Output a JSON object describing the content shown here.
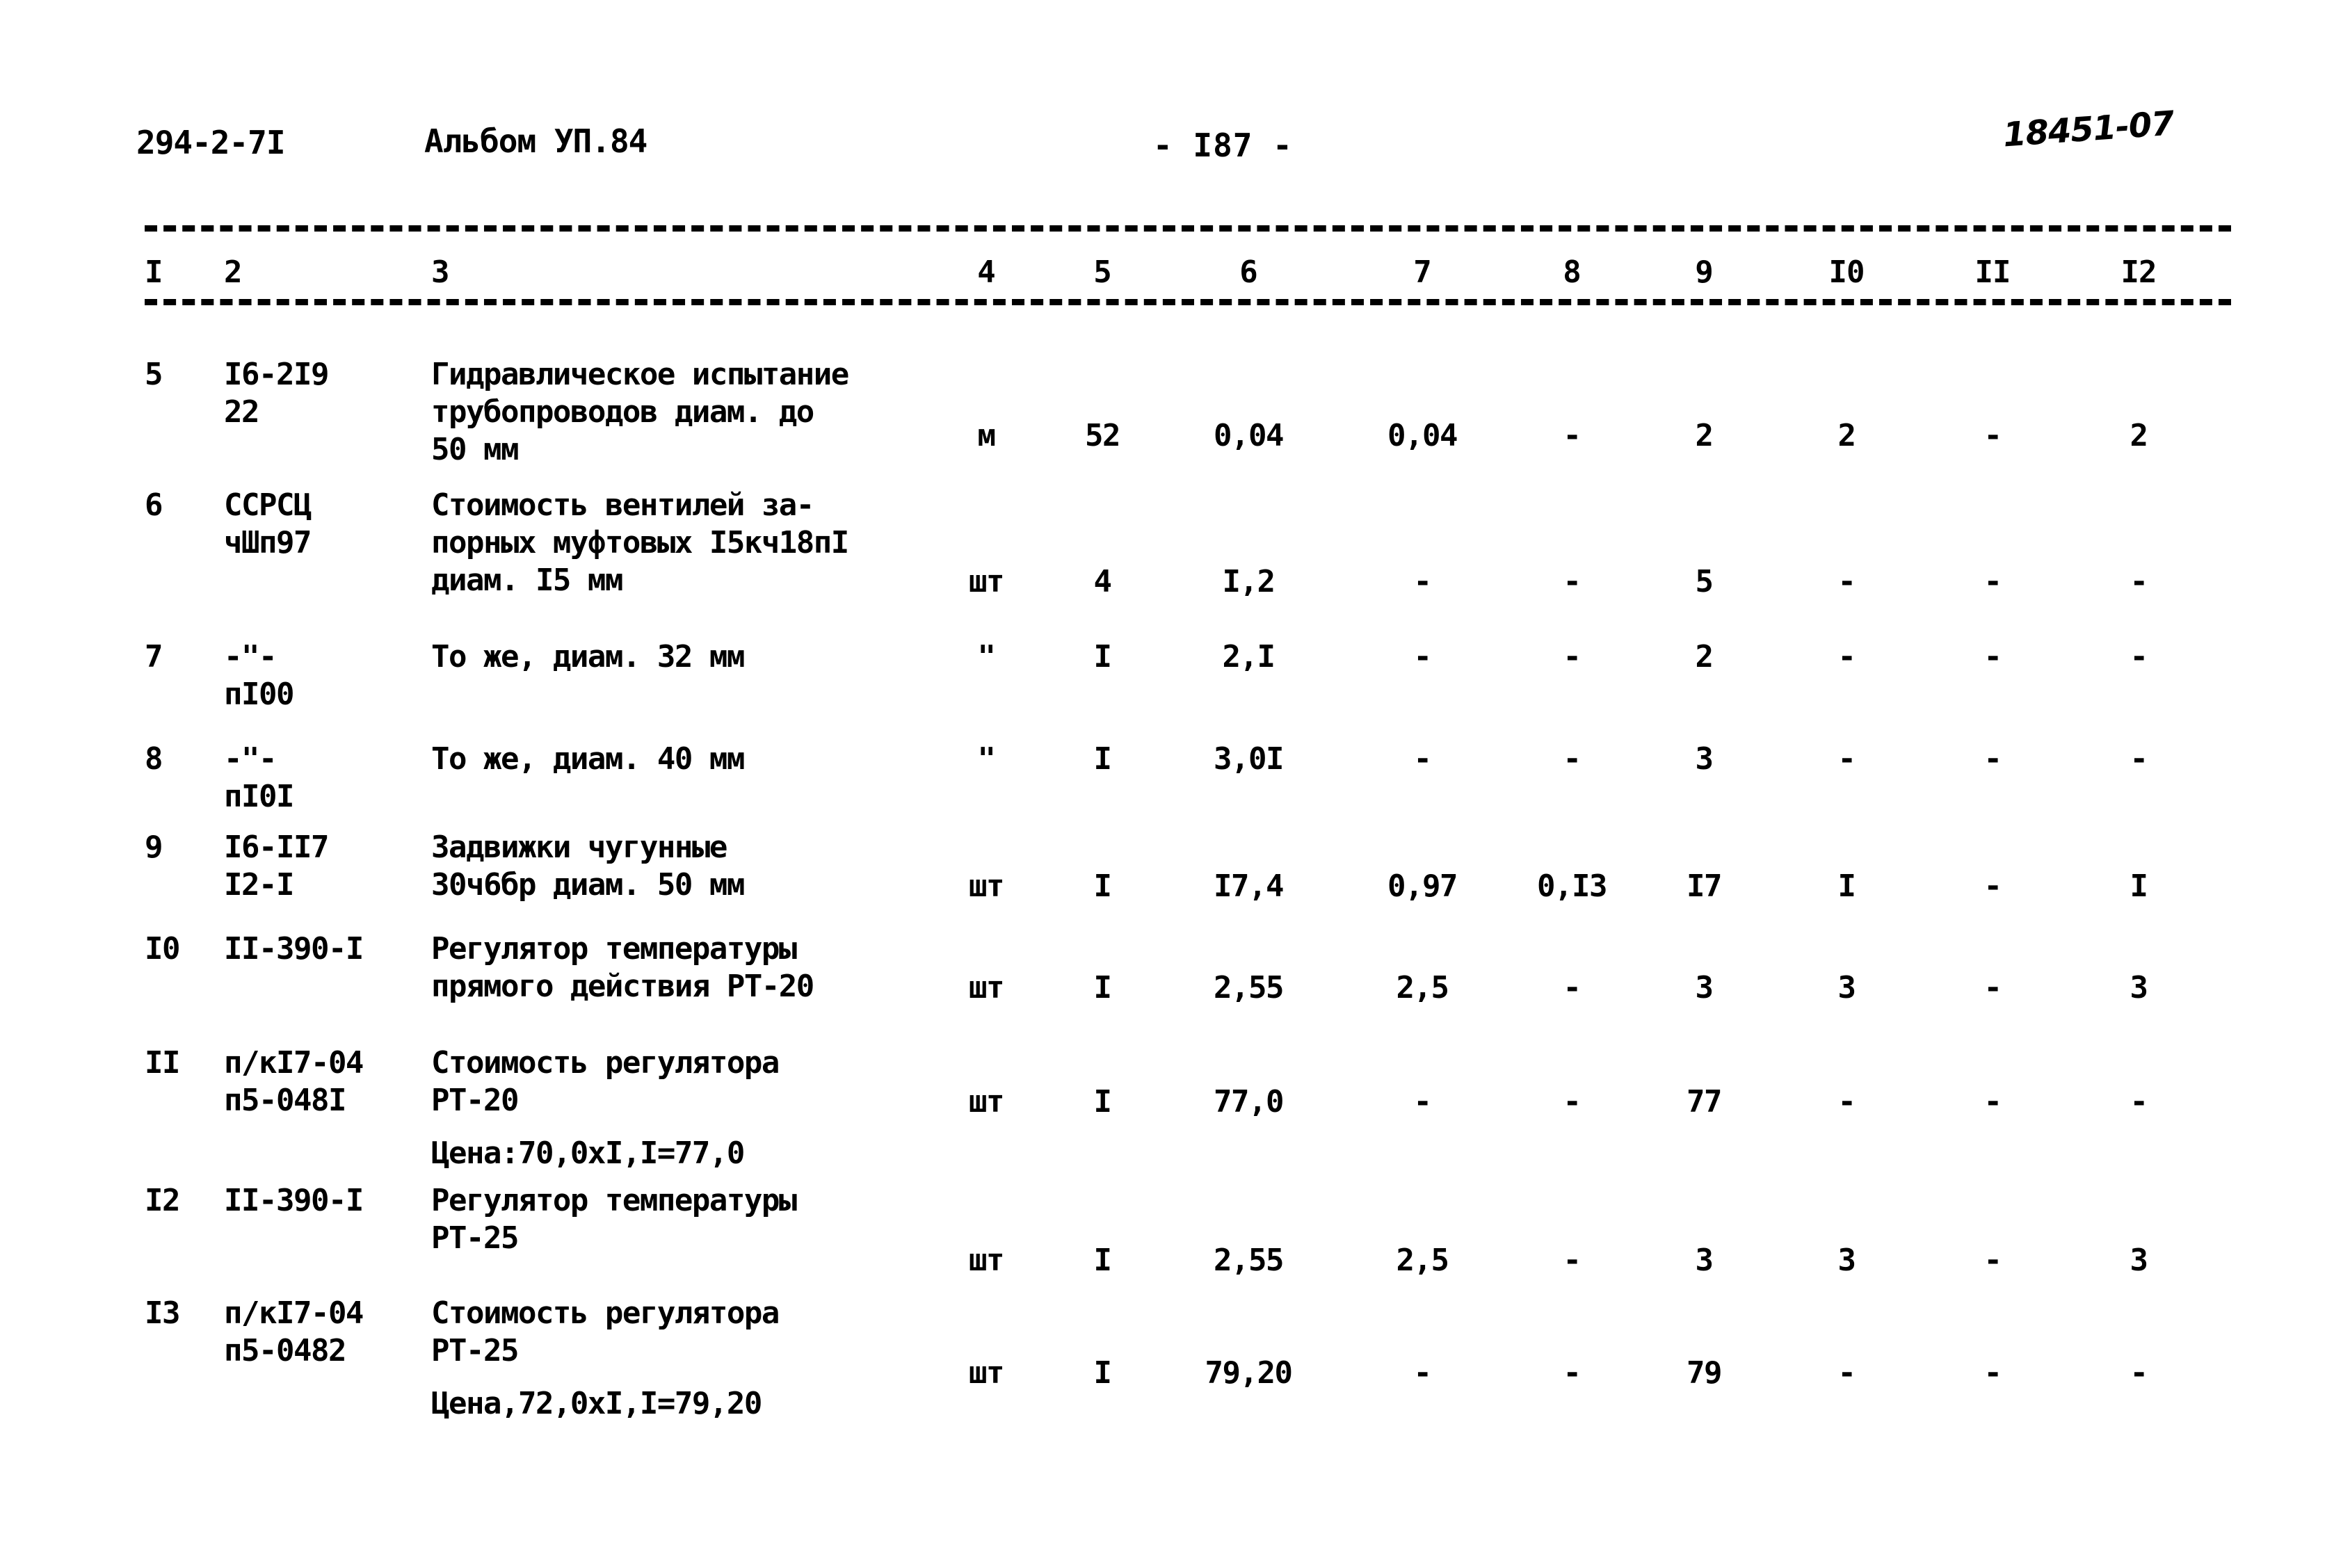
{
  "header": {
    "doc_code": "294-2-7I",
    "album": "Альбом УП.84",
    "page_label": "- I87 -",
    "stamp": "18451-07"
  },
  "table": {
    "column_headers": [
      "I",
      "2",
      "3",
      "4",
      "5",
      "6",
      "7",
      "8",
      "9",
      "I0",
      "II",
      "I2"
    ],
    "rows": [
      {
        "num": "5",
        "code_line1": "I6-2I9",
        "code_line2": "22",
        "desc_line1": "Гидравлическое испытание",
        "desc_line2": "трубопроводов диам. до",
        "desc_line3": "50 мм",
        "price_note": "",
        "unit": "м",
        "c5": "52",
        "c6": "0,04",
        "c7": "0,04",
        "c8": "-",
        "c9": "2",
        "c10": "2",
        "c11": "-",
        "c12": "2"
      },
      {
        "num": "6",
        "code_line1": "ССРСЦ",
        "code_line2": "чШп97",
        "desc_line1": "Стоимость вентилей за-",
        "desc_line2": "порных муфтовых I5кч18пI",
        "desc_line3": "диам. I5 мм",
        "price_note": "",
        "unit": "шт",
        "c5": "4",
        "c6": "I,2",
        "c7": "-",
        "c8": "-",
        "c9": "5",
        "c10": "-",
        "c11": "-",
        "c12": "-"
      },
      {
        "num": "7",
        "code_line1": "-\"-",
        "code_line2": "пI00",
        "desc_line1": "То же, диам. 32 мм",
        "desc_line2": "",
        "desc_line3": "",
        "price_note": "",
        "unit": "\"",
        "c5": "I",
        "c6": "2,I",
        "c7": "-",
        "c8": "-",
        "c9": "2",
        "c10": "-",
        "c11": "-",
        "c12": "-"
      },
      {
        "num": "8",
        "code_line1": "-\"-",
        "code_line2": "пI0I",
        "desc_line1": "То же, диам. 40 мм",
        "desc_line2": "",
        "desc_line3": "",
        "price_note": "",
        "unit": "\"",
        "c5": "I",
        "c6": "3,0I",
        "c7": "-",
        "c8": "-",
        "c9": "3",
        "c10": "-",
        "c11": "-",
        "c12": "-"
      },
      {
        "num": "9",
        "code_line1": "I6-II7",
        "code_line2": "I2-I",
        "desc_line1": "Задвижки чугунные",
        "desc_line2": "30ч6бр диам. 50 мм",
        "desc_line3": "",
        "price_note": "",
        "unit": "шт",
        "c5": "I",
        "c6": "I7,4",
        "c7": "0,97",
        "c8": "0,I3",
        "c9": "I7",
        "c10": "I",
        "c11": "-",
        "c12": "I"
      },
      {
        "num": "I0",
        "code_line1": "II-390-I",
        "code_line2": "",
        "desc_line1": "Регулятор температуры",
        "desc_line2": "прямого действия РТ-20",
        "desc_line3": "",
        "price_note": "",
        "unit": "шт",
        "c5": "I",
        "c6": "2,55",
        "c7": "2,5",
        "c8": "-",
        "c9": "3",
        "c10": "3",
        "c11": "-",
        "c12": "3"
      },
      {
        "num": "II",
        "code_line1": "п/кI7-04",
        "code_line2": "п5-048I",
        "desc_line1": "Стоимость регулятора",
        "desc_line2": "РТ-20",
        "desc_line3": "",
        "price_note": "Цена:70,0хI,I=77,0",
        "unit": "шт",
        "c5": "I",
        "c6": "77,0",
        "c7": "-",
        "c8": "-",
        "c9": "77",
        "c10": "-",
        "c11": "-",
        "c12": "-"
      },
      {
        "num": "I2",
        "code_line1": "II-390-I",
        "code_line2": "",
        "desc_line1": "Регулятор температуры",
        "desc_line2": "РТ-25",
        "desc_line3": "",
        "price_note": "",
        "unit": "шт",
        "c5": "I",
        "c6": "2,55",
        "c7": "2,5",
        "c8": "-",
        "c9": "3",
        "c10": "3",
        "c11": "-",
        "c12": "3"
      },
      {
        "num": "I3",
        "code_line1": "п/кI7-04",
        "code_line2": "п5-0482",
        "desc_line1": "Стоимость регулятора",
        "desc_line2": "РТ-25",
        "desc_line3": "",
        "price_note": "Цена,72,0хI,I=79,20",
        "unit": "шт",
        "c5": "I",
        "c6": "79,20",
        "c7": "-",
        "c8": "-",
        "c9": "79",
        "c10": "-",
        "c11": "-",
        "c12": "-"
      }
    ]
  }
}
